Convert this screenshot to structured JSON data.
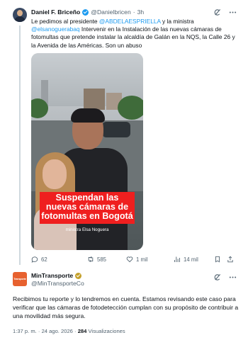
{
  "tweet1": {
    "name": "Daniel F. Briceño",
    "handle": "@Danielbricen",
    "sep": "·",
    "time": "3h",
    "text_parts": [
      "Le pedimos al presidente ",
      "@ABDELAESPRIELLA",
      " y la ministra ",
      "@elsanoguerabaq",
      " Intervenir en la Instalación de las nuevas cámaras de fotomultas que pretende instalar la alcaldía de Galán en la NQS, la Calle 26 y la Avenida de las Américas. Son un abuso"
    ],
    "media": {
      "overlay": "Suspendan las nuevas cámaras de fotomultas en Bogotá",
      "caption": "ministra Elsa Noguera"
    },
    "actions": {
      "replies": "62",
      "retweets": "585",
      "likes": "1 mil",
      "views": "14 mil"
    },
    "top_icons": [
      "grok-icon",
      "more-icon"
    ]
  },
  "tweet2": {
    "name": "MinTransporte",
    "handle": "@MinTransporteCo",
    "avatar_text": "Transporte",
    "text": "Recibimos tu reporte y lo tendremos en cuenta. Estamos revisando este caso para verificar que las cámaras de fotodetección cumplan con su propósito de contribuir a una movilidad más segura.",
    "time": "1:37 p. m.",
    "date": "24 ago. 2026",
    "views": "284",
    "views_label": "Visualizaciones",
    "sep": "·"
  },
  "colors": {
    "link": "#1d9bf0",
    "verified_blue": "#1d9bf0",
    "verified_gold": "#c4a02a",
    "overlay_red": "#ef1f1f",
    "brand_orange": "#e7612f"
  }
}
